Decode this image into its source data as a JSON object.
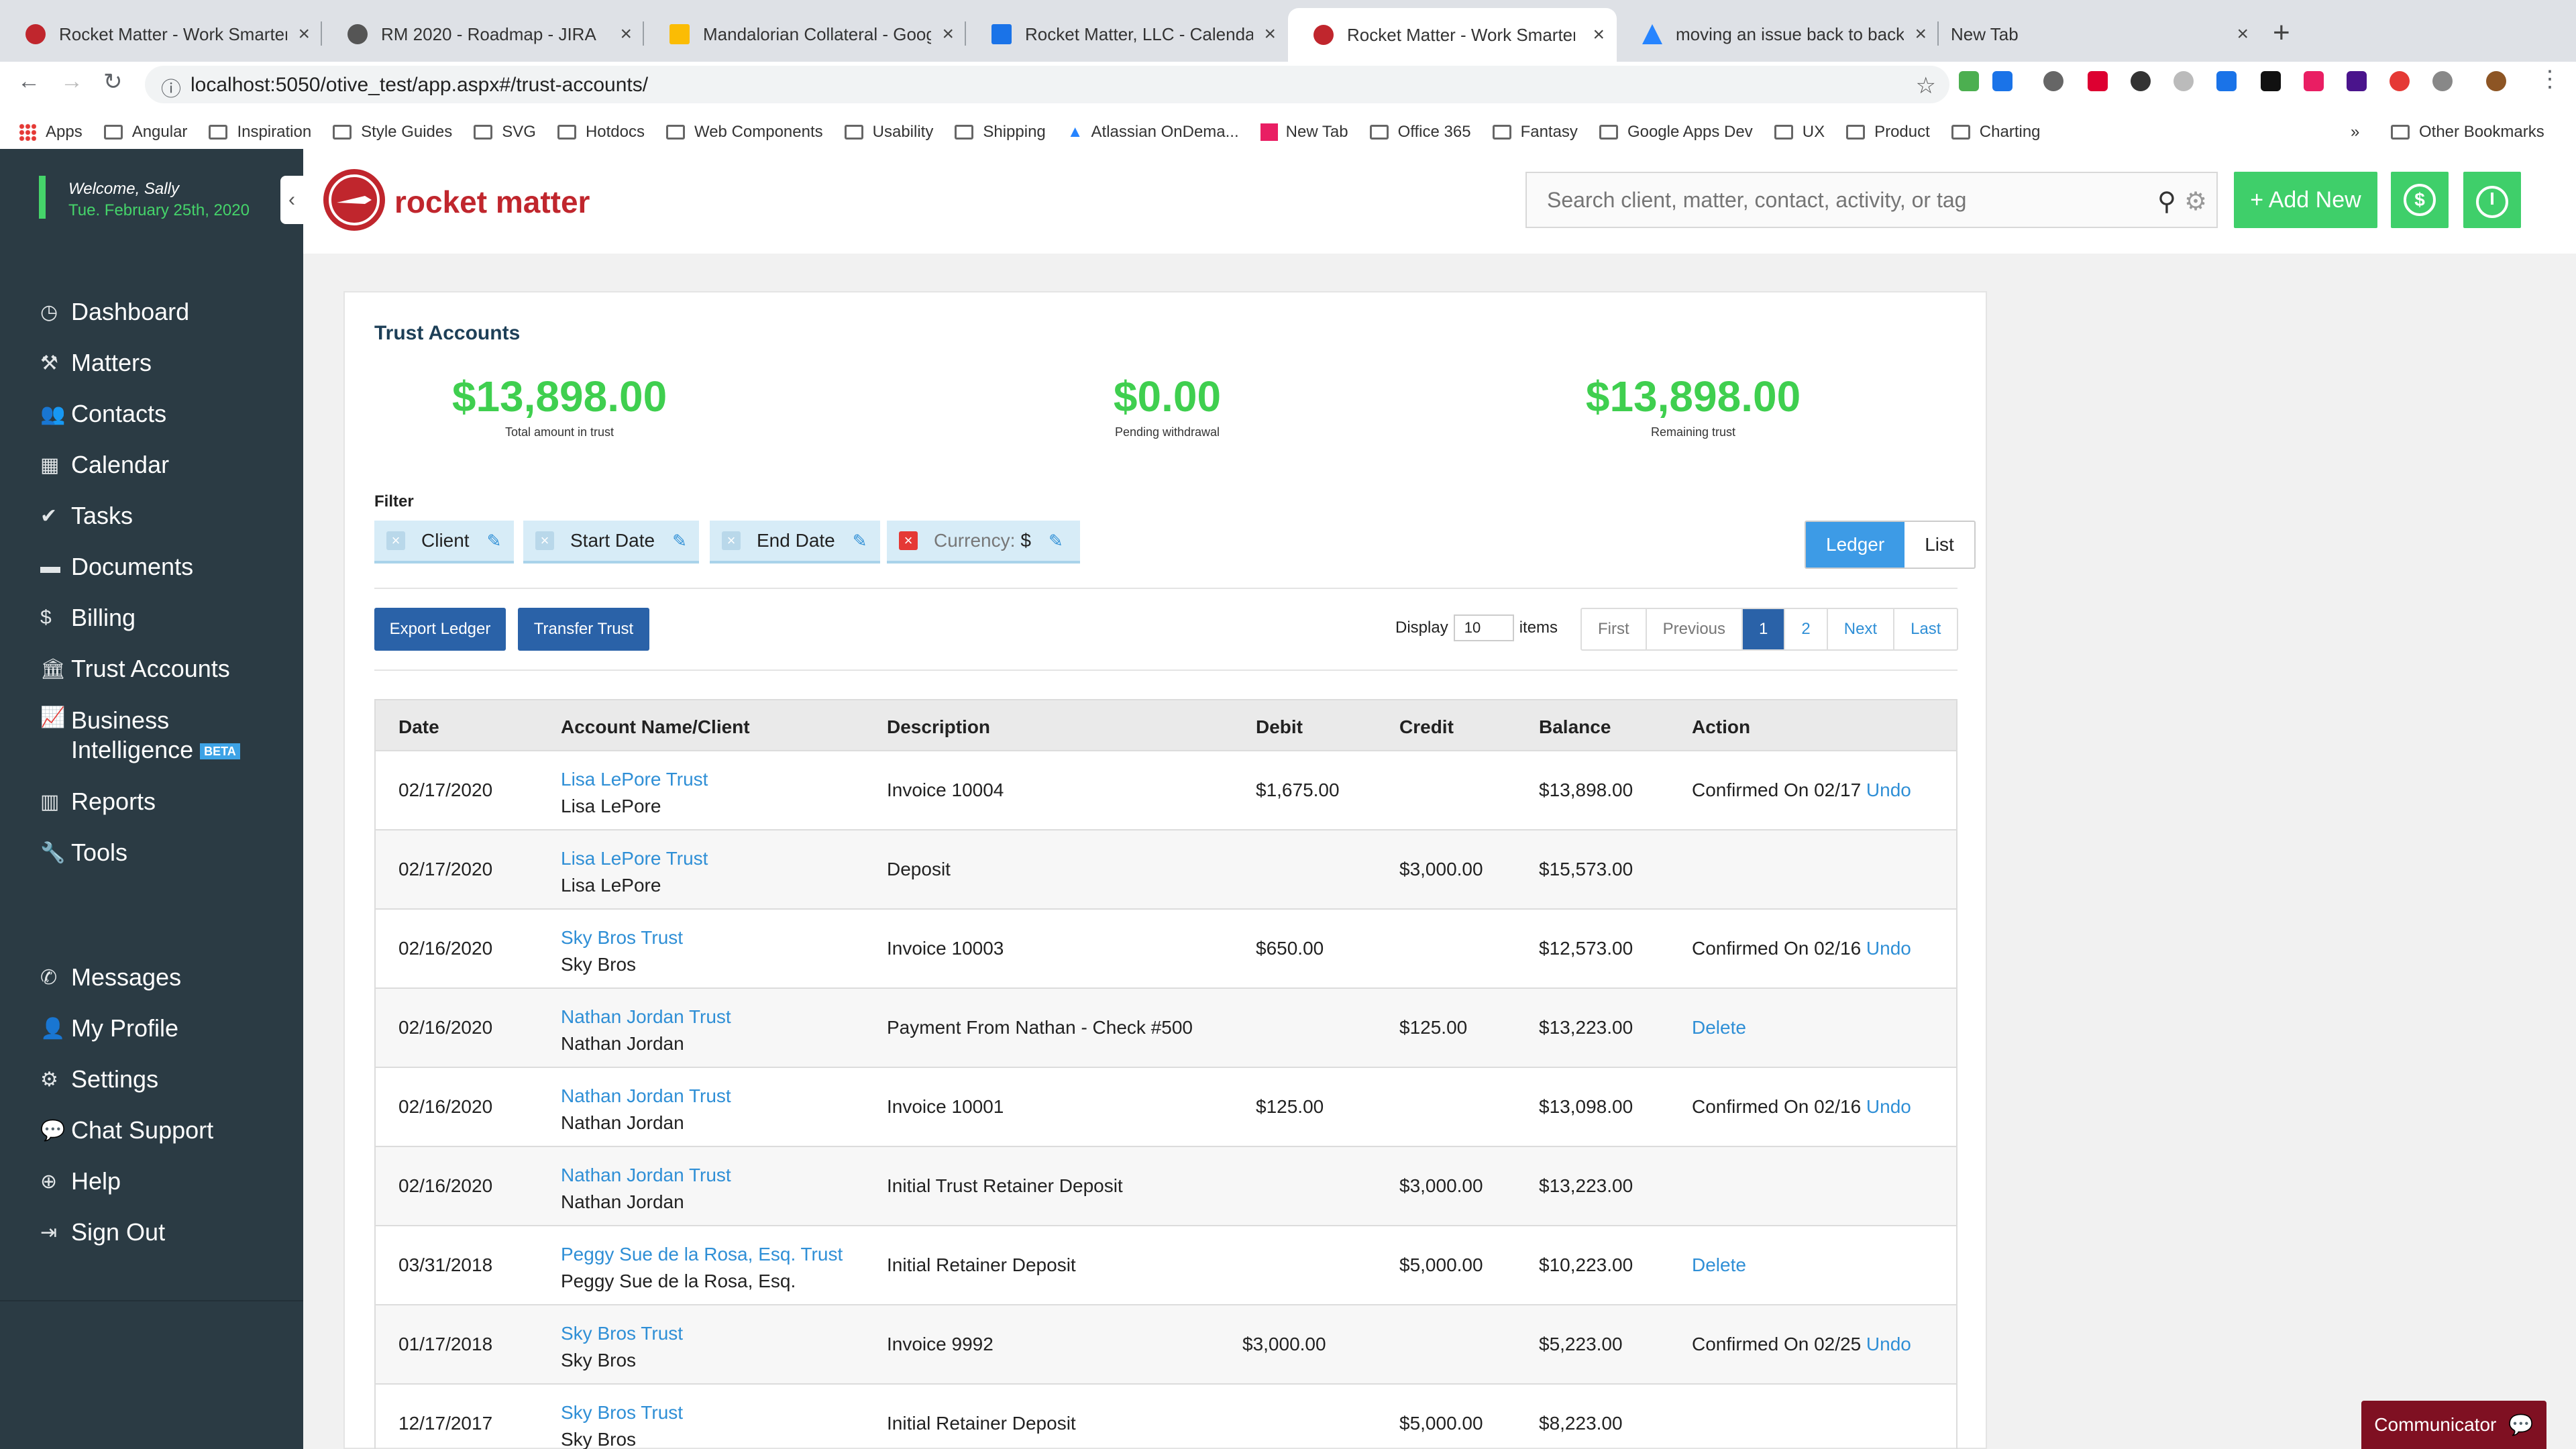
{
  "browser": {
    "tabs": [
      {
        "title": "Rocket Matter - Work Smarter.",
        "color": "#c0262d"
      },
      {
        "title": "RM 2020 - Roadmap - JIRA",
        "color": "#555555"
      },
      {
        "title": "Mandalorian Collateral - Google",
        "color": "#fbbc04"
      },
      {
        "title": "Rocket Matter, LLC - Calendar",
        "color": "#1a73e8"
      },
      {
        "title": "Rocket Matter - Work Smarter.",
        "color": "#c0262d"
      },
      {
        "title": "moving an issue back to backlo",
        "color": "#2684ff"
      },
      {
        "title": "New Tab",
        "color": "#dee1e6"
      }
    ],
    "url": "localhost:5050/otive_test/app.aspx#/trust-accounts/",
    "bookmarks": [
      "Apps",
      "Angular",
      "Inspiration",
      "Style Guides",
      "SVG",
      "Hotdocs",
      "Web Components",
      "Usability",
      "Shipping",
      "Atlassian OnDema...",
      "New Tab",
      "Office 365",
      "Fantasy",
      "Google Apps Dev",
      "UX",
      "Product",
      "Charting"
    ],
    "bookmarks_more": "»",
    "other_bookmarks": "Other Bookmarks"
  },
  "sidebar": {
    "welcome": "Welcome, Sally",
    "date": "Tue. February 25th, 2020",
    "nav": [
      {
        "icon": "◷",
        "label": "Dashboard"
      },
      {
        "icon": "⚒",
        "label": "Matters"
      },
      {
        "icon": "👥",
        "label": "Contacts"
      },
      {
        "icon": "▦",
        "label": "Calendar"
      },
      {
        "icon": "✔",
        "label": "Tasks"
      },
      {
        "icon": "▬",
        "label": "Documents"
      },
      {
        "icon": "$",
        "label": "Billing"
      },
      {
        "icon": "🏛",
        "label": "Trust Accounts"
      },
      {
        "icon": "📈",
        "label": "Business"
      },
      {
        "icon": "▥",
        "label": "Reports"
      },
      {
        "icon": "🔧",
        "label": "Tools"
      }
    ],
    "bi_line2": "Intelligence",
    "beta": "BETA",
    "bottom_nav": [
      {
        "icon": "✆",
        "label": "Messages"
      },
      {
        "icon": "👤",
        "label": "My Profile"
      },
      {
        "icon": "⚙",
        "label": "Settings"
      },
      {
        "icon": "💬",
        "label": "Chat Support"
      },
      {
        "icon": "⊕",
        "label": "Help"
      },
      {
        "icon": "⇥",
        "label": "Sign Out"
      }
    ]
  },
  "header": {
    "logo": "rocket matter",
    "search_placeholder": "Search client, matter, contact, activity, or tag",
    "add_new": "+ Add New"
  },
  "trust": {
    "title": "Trust Accounts",
    "stats": [
      {
        "value": "$13,898.00",
        "label": "Total amount in trust"
      },
      {
        "value": "$0.00",
        "label": "Pending withdrawal"
      },
      {
        "value": "$13,898.00",
        "label": "Remaining trust"
      }
    ],
    "filter_label": "Filter",
    "filters": [
      "Client",
      "Start Date",
      "End Date",
      "Currency:"
    ],
    "currency_value": "$",
    "view_ledger": "Ledger",
    "view_list": "List",
    "export_ledger": "Export Ledger",
    "transfer_trust": "Transfer Trust",
    "display_label": "Display",
    "display_value": "10",
    "items_label": "items",
    "pager": [
      "First",
      "Previous",
      "1",
      "2",
      "Next",
      "Last"
    ],
    "columns": [
      "Date",
      "Account Name/Client",
      "Description",
      "Debit",
      "Credit",
      "Balance",
      "Action"
    ],
    "rows": [
      {
        "date": "02/17/2020",
        "account": "Lisa LePore Trust",
        "client": "Lisa LePore",
        "desc": "Invoice 10004",
        "debit": "$1,675.00",
        "credit": "",
        "balance": "$13,898.00",
        "action": "Confirmed On 02/17",
        "action_link": "Undo"
      },
      {
        "date": "02/17/2020",
        "account": "Lisa LePore Trust",
        "client": "Lisa LePore",
        "desc": "Deposit",
        "debit": "",
        "credit": "$3,000.00",
        "balance": "$15,573.00",
        "action": "",
        "action_link": ""
      },
      {
        "date": "02/16/2020",
        "account": "Sky Bros Trust",
        "client": "Sky Bros",
        "desc": "Invoice 10003",
        "debit": "$650.00",
        "credit": "",
        "balance": "$12,573.00",
        "action": "Confirmed On 02/16",
        "action_link": "Undo"
      },
      {
        "date": "02/16/2020",
        "account": "Nathan Jordan Trust",
        "client": "Nathan Jordan",
        "desc": "Payment From Nathan - Check #500",
        "debit": "",
        "credit": "$125.00",
        "balance": "$13,223.00",
        "action": "",
        "action_link": "Delete"
      },
      {
        "date": "02/16/2020",
        "account": "Nathan Jordan Trust",
        "client": "Nathan Jordan",
        "desc": "Invoice 10001",
        "debit": "$125.00",
        "credit": "",
        "balance": "$13,098.00",
        "action": "Confirmed On 02/16",
        "action_link": "Undo"
      },
      {
        "date": "02/16/2020",
        "account": "Nathan Jordan Trust",
        "client": "Nathan Jordan",
        "desc": "Initial Trust Retainer Deposit",
        "debit": "",
        "credit": "$3,000.00",
        "balance": "$13,223.00",
        "action": "",
        "action_link": ""
      },
      {
        "date": "03/31/2018",
        "account": "Peggy Sue de la Rosa, Esq. Trust",
        "client": "Peggy Sue de la Rosa, Esq.",
        "desc": "Initial Retainer Deposit",
        "debit": "",
        "credit": "$5,000.00",
        "balance": "$10,223.00",
        "action": "",
        "action_link": "Delete"
      },
      {
        "date": "01/17/2018",
        "account": "Sky Bros Trust",
        "client": "Sky Bros",
        "desc": "Invoice 9992",
        "debit": "$3,000.00",
        "credit": "",
        "balance": "$5,223.00",
        "action": "Confirmed On 02/25",
        "action_link": "Undo"
      },
      {
        "date": "12/17/2017",
        "account": "Sky Bros Trust",
        "client": "Sky Bros",
        "desc": "Initial Retainer Deposit",
        "debit": "",
        "credit": "$5,000.00",
        "balance": "$8,223.00",
        "action": "",
        "action_link": ""
      }
    ]
  },
  "communicator": "Communicator"
}
